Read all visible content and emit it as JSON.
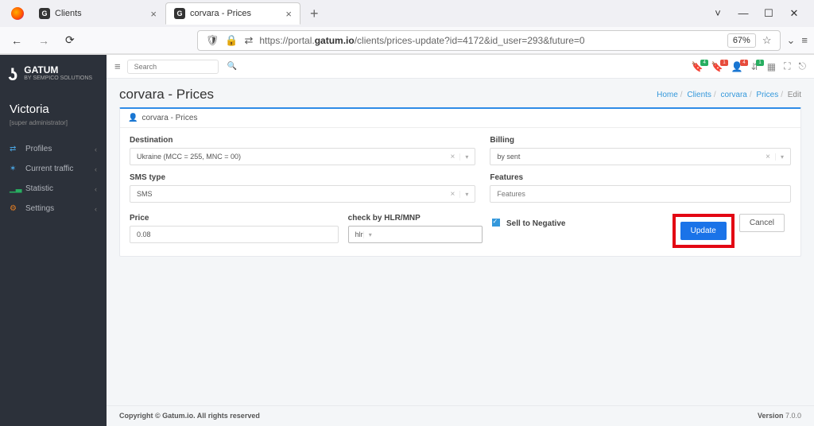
{
  "browser": {
    "tabs": [
      {
        "title": "Clients"
      },
      {
        "title": "corvara - Prices"
      }
    ],
    "url_prefix": "https://portal.",
    "url_domain": "gatum.io",
    "url_path": "/clients/prices-update?id=4172&id_user=293&future=0",
    "zoom": "67%"
  },
  "sidebar": {
    "brand_top": "GATUM",
    "brand_sub": "BY SEMPICO SOLUTIONS",
    "user": "Victoria",
    "role": "[super administrator]",
    "items": [
      {
        "label": "Profiles",
        "icon": "⇄",
        "color": "#4aa3df"
      },
      {
        "label": "Current traffic",
        "icon": "✶",
        "color": "#4aa3df"
      },
      {
        "label": "Statistic",
        "icon": "▁▃",
        "color": "#27ae60"
      },
      {
        "label": "Settings",
        "icon": "⚙",
        "color": "#e67e22"
      }
    ]
  },
  "topbar": {
    "search_placeholder": "Search",
    "badges": [
      "4",
      "1",
      "4",
      "1"
    ]
  },
  "page": {
    "title": "corvara - Prices",
    "panel_title": "corvara - Prices",
    "breadcrumb": {
      "home": "Home",
      "clients": "Clients",
      "corvara": "corvara",
      "prices": "Prices",
      "edit": "Edit"
    }
  },
  "form": {
    "destination_label": "Destination",
    "destination_value": "Ukraine (MCC = 255, MNC = 00)",
    "smstype_label": "SMS type",
    "smstype_value": "SMS",
    "price_label": "Price",
    "price_value": "0.08",
    "check_label": "check by HLR/MNP",
    "check_value": "hlr",
    "sell_label": "Sell to Negative",
    "billing_label": "Billing",
    "billing_value": "by sent",
    "features_label": "Features",
    "features_placeholder": "Features",
    "update_btn": "Update",
    "cancel_btn": "Cancel"
  },
  "footer": {
    "copyright": "Copyright © Gatum.io. All rights reserved",
    "version_label": "Version ",
    "version_num": "7.0.0"
  }
}
